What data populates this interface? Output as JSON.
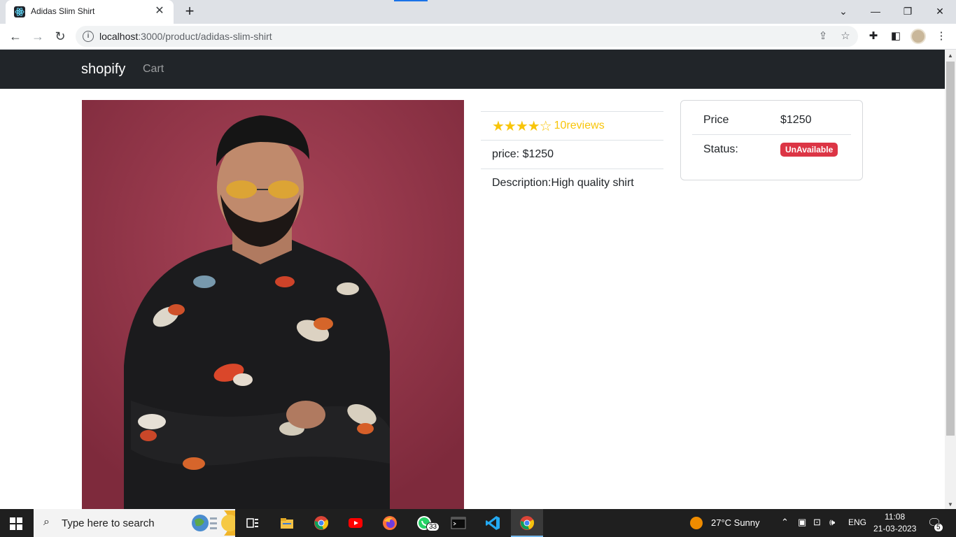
{
  "browser": {
    "tab_title": "Adidas Slim Shirt",
    "tab_close": "✕",
    "new_tab": "+",
    "url_host": "localhost",
    "url_rest": ":3000/product/adidas-slim-shirt",
    "window_controls": [
      "⌄",
      "—",
      "❐",
      "✕"
    ]
  },
  "navbar": {
    "brand": "shopify",
    "links": [
      "Cart"
    ]
  },
  "product": {
    "image_alt": "Man wearing black floral shirt",
    "rating": 4,
    "rating_max": 5,
    "stars": "★★★★☆",
    "reviews_label": "10reviews",
    "price_line": "price: $1250",
    "description_line": "Description:High quality shirt"
  },
  "card": {
    "price_label": "Price",
    "price_value": "$1250",
    "status_label": "Status:",
    "status_value": "UnAvailable",
    "status_color": "#dc3545"
  },
  "taskbar": {
    "search_placeholder": "Type here to search",
    "weather": "27°C  Sunny",
    "language": "ENG",
    "time": "11:08",
    "date": "21-03-2023",
    "whatsapp_badge": "33",
    "notification_count": "5"
  }
}
